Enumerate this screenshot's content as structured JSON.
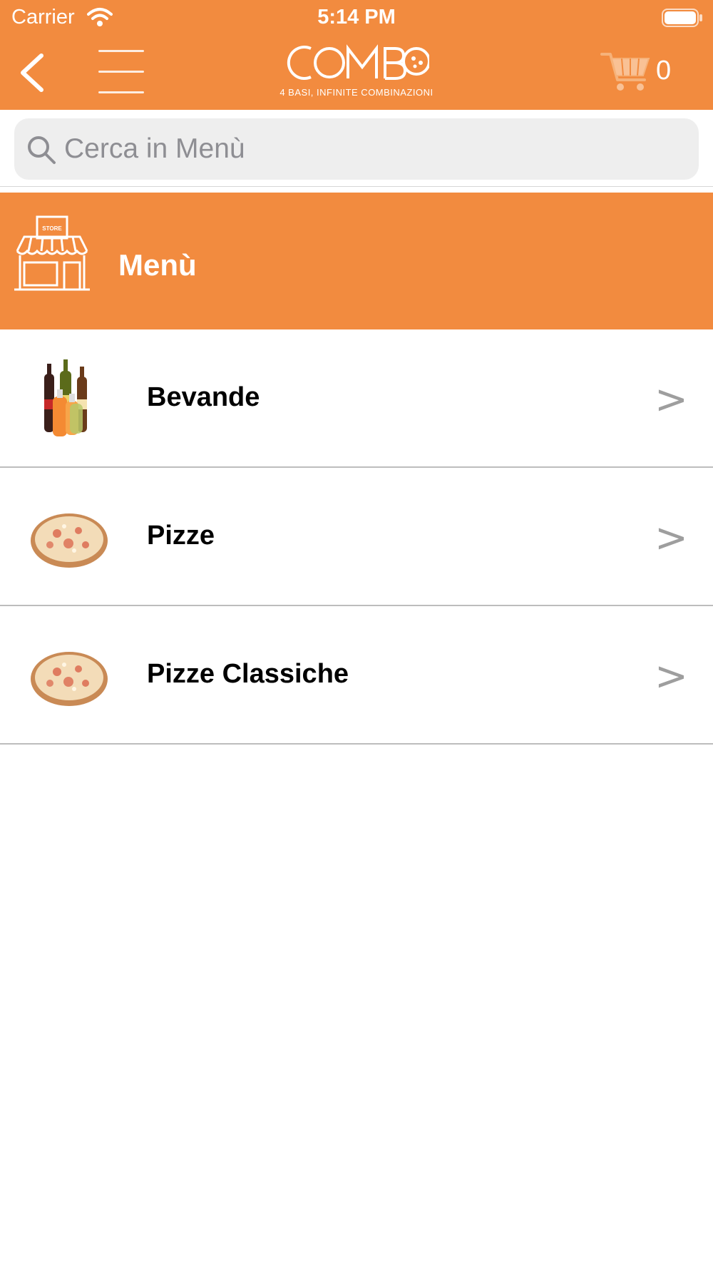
{
  "status_bar": {
    "carrier": "Carrier",
    "time": "5:14 PM"
  },
  "header": {
    "logo_word": "COMBO",
    "logo_tagline": "4 BASI, INFINITE COMBINAZIONI",
    "cart_count": "0",
    "accent_color": "#F28B3F"
  },
  "search": {
    "placeholder": "Cerca in Menù",
    "value": ""
  },
  "section": {
    "title": "Menù",
    "icon_label": "STORE"
  },
  "categories": [
    {
      "label": "Bevande",
      "icon": "drink-bottles-thumbnail",
      "chevron": ">"
    },
    {
      "label": "Pizze",
      "icon": "pizza-thumbnail",
      "chevron": ">"
    },
    {
      "label": "Pizze Classiche",
      "icon": "pizza-thumbnail",
      "chevron": ">"
    }
  ]
}
